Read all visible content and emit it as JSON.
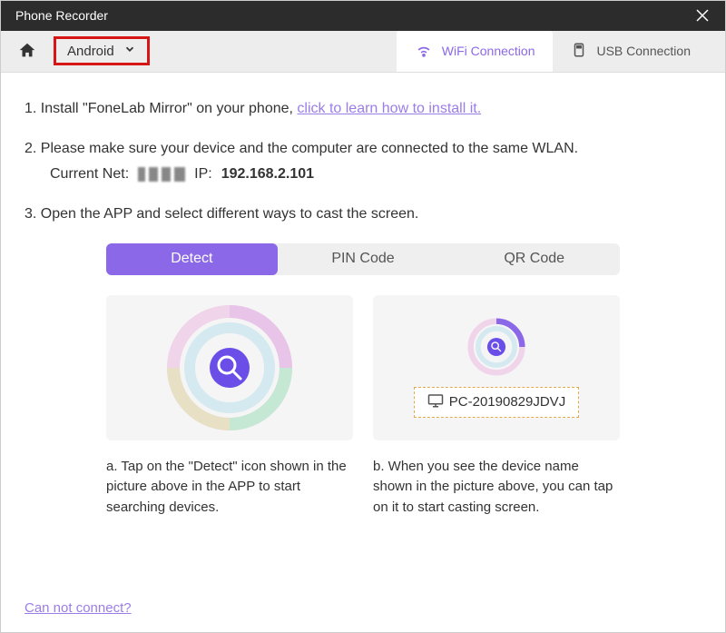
{
  "titlebar": {
    "title": "Phone Recorder"
  },
  "toolbar": {
    "platform": "Android",
    "tabs": {
      "wifi": "WiFi Connection",
      "usb": "USB Connection"
    }
  },
  "steps": {
    "s1_prefix": "1. Install \"FoneLab Mirror\" on your phone, ",
    "s1_link": "click to learn how to install it.",
    "s2": "2. Please make sure your device and the computer are connected to the same WLAN.",
    "net_label": "Current Net:",
    "ip_label": "IP:",
    "ip_value": "192.168.2.101",
    "s3": "3. Open the APP and select different ways to cast the screen."
  },
  "modes": {
    "detect": "Detect",
    "pin": "PIN Code",
    "qr": "QR Code"
  },
  "device_name": "PC-20190829JDVJ",
  "captions": {
    "a": "a. Tap on the \"Detect\" icon shown in the picture above in the APP to start searching devices.",
    "b": "b. When you see the device name shown in the picture above, you can tap on it to start casting screen."
  },
  "footer_link": "Can not connect?"
}
